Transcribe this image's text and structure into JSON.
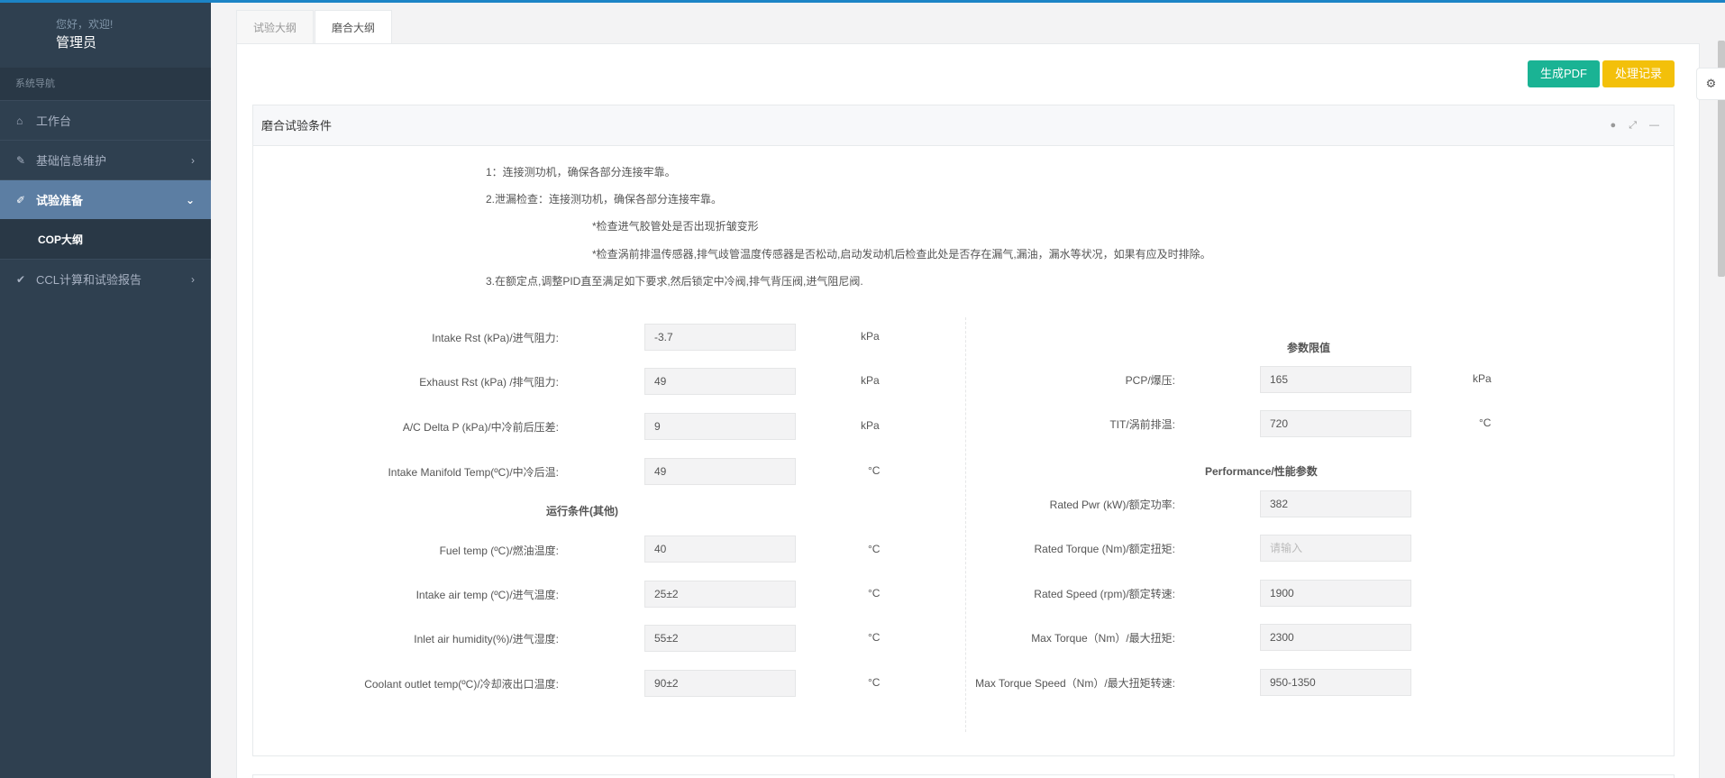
{
  "sidebar": {
    "greeting": "您好，欢迎!",
    "username": "管理员",
    "nav_header": "系统导航",
    "items": [
      {
        "label": "工作台",
        "icon": "home-icon"
      },
      {
        "label": "基础信息维护",
        "icon": "wrench-icon"
      },
      {
        "label": "试验准备",
        "icon": "pencil-icon"
      },
      {
        "label": "CCL计算和试验报告",
        "icon": "check-icon"
      }
    ],
    "sub_item": "COP大纲"
  },
  "tabs": [
    "试验大纲",
    "磨合大纲"
  ],
  "actions": {
    "pdf": "生成PDF",
    "records": "处理记录"
  },
  "ibox_title": "磨合试验条件",
  "steps": [
    "1：连接测功机，确保各部分连接牢靠。",
    "2.泄漏检查：连接测功机，确保各部分连接牢靠。",
    "*检查进气胶管处是否出现折皱变形",
    "*检查涡前排温传感器,排气歧管温度传感器是否松动,启动发动机后检查此处是否存在漏气,漏油，漏水等状况，如果有应及时排除。",
    "3.在额定点,调整PID直至满足如下要求,然后锁定中冷阀,排气背压阀,进气阻尼阀."
  ],
  "left_fields": [
    {
      "label": "Intake Rst (kPa)/进气阻力:",
      "value": "-3.7",
      "unit": "kPa"
    },
    {
      "label": "Exhaust Rst (kPa) /排气阻力:",
      "value": "49",
      "unit": "kPa"
    },
    {
      "label": "A/C Delta P (kPa)/中冷前后压差:",
      "value": "9",
      "unit": "kPa"
    },
    {
      "label": "Intake Manifold Temp(ºC)/中冷后温:",
      "value": "49",
      "unit": "°C"
    }
  ],
  "left_section": "运行条件(其他)",
  "left_fields2": [
    {
      "label": "Fuel temp (ºC)/燃油温度:",
      "value": "40",
      "unit": "°C"
    },
    {
      "label": "Intake air temp (ºC)/进气温度:",
      "value": "25±2",
      "unit": "°C"
    },
    {
      "label": "Inlet air humidity(%)/进气湿度:",
      "value": "55±2",
      "unit": "°C"
    },
    {
      "label": "Coolant outlet temp(ºC)/冷却液出口温度:",
      "value": "90±2",
      "unit": "°C"
    }
  ],
  "right_section1": "参数限值",
  "right_fields": [
    {
      "label": "PCP/爆压:",
      "value": "165",
      "unit": "kPa"
    },
    {
      "label": "TIT/涡前排温:",
      "value": "720",
      "unit": "°C"
    }
  ],
  "right_section2": "Performance/性能参数",
  "right_fields2": [
    {
      "label": "Rated Pwr (kW)/额定功率:",
      "value": "382",
      "placeholder": ""
    },
    {
      "label": "Rated Torque (Nm)/额定扭矩:",
      "value": "",
      "placeholder": "请输入"
    },
    {
      "label": "Rated Speed (rpm)/额定转速:",
      "value": "1900",
      "placeholder": ""
    },
    {
      "label": "Max Torque（Nm）/最大扭矩:",
      "value": "2300",
      "placeholder": ""
    },
    {
      "label": "Max Torque Speed（Nm）/最大扭矩转速:",
      "value": "950-1350",
      "placeholder": ""
    }
  ]
}
